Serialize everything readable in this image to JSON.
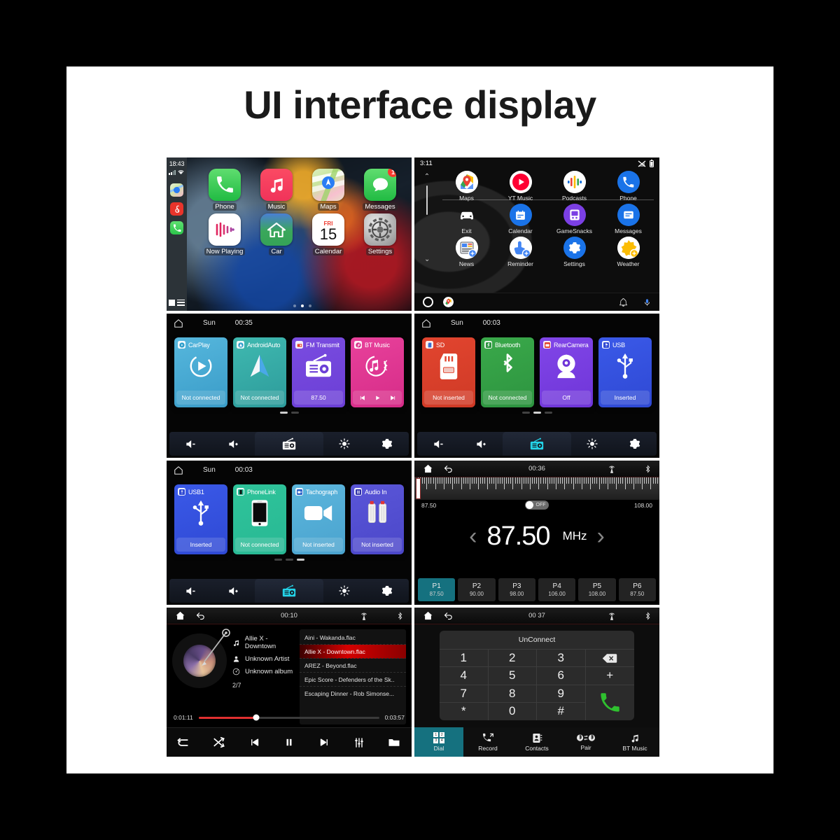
{
  "page": {
    "title": "UI interface display"
  },
  "carplay": {
    "status": {
      "time": "18:43",
      "signal_icon": "cellular-signal-icon",
      "wifi_icon": "wifi-icon"
    },
    "sidebar_icons": [
      "maps-icon",
      "netease-music-icon",
      "phone-icon"
    ],
    "dock_icon": "app-library-icon",
    "apps": [
      {
        "label": "Phone",
        "icon": "phone-icon",
        "badge": ""
      },
      {
        "label": "Music",
        "icon": "music-note-icon",
        "badge": ""
      },
      {
        "label": "Maps",
        "icon": "maps-icon",
        "badge": ""
      },
      {
        "label": "Messages",
        "icon": "messages-bubble-icon",
        "badge": "1"
      },
      {
        "label": "Now Playing",
        "icon": "now-playing-icon",
        "badge": ""
      },
      {
        "label": "Car",
        "icon": "home-car-icon",
        "badge": ""
      },
      {
        "label": "Calendar",
        "icon": "calendar-icon",
        "badge": "",
        "day_name": "FRI",
        "day_num": "15"
      },
      {
        "label": "Settings",
        "icon": "gear-icon",
        "badge": ""
      }
    ],
    "page_dots": {
      "count": 3,
      "active_index": 1
    }
  },
  "androidauto": {
    "status": {
      "time": "3:11",
      "signal_icon": "no-signal-icon",
      "battery_icon": "battery-icon"
    },
    "apps": [
      {
        "label": "Maps",
        "icon": "google-maps-icon"
      },
      {
        "label": "YT Music",
        "icon": "youtube-music-icon"
      },
      {
        "label": "Podcasts",
        "icon": "google-podcasts-icon"
      },
      {
        "label": "Phone",
        "icon": "phone-icon"
      },
      {
        "label": "Exit",
        "icon": "car-exit-icon"
      },
      {
        "label": "Calendar",
        "icon": "calendar-icon"
      },
      {
        "label": "GameSnacks",
        "icon": "gamesnacks-icon"
      },
      {
        "label": "Messages",
        "icon": "messages-icon"
      },
      {
        "label": "News",
        "icon": "news-icon"
      },
      {
        "label": "Reminder",
        "icon": "reminder-icon"
      },
      {
        "label": "Settings",
        "icon": "gear-icon"
      },
      {
        "label": "Weather",
        "icon": "weather-sun-icon"
      }
    ],
    "bottom": {
      "home_icon": "circle-home-icon",
      "maps_icon": "google-maps-icon",
      "bell_icon": "bell-icon",
      "mic_icon": "microphone-icon"
    }
  },
  "tiles_page1": {
    "header": {
      "home_icon": "home-icon",
      "day": "Sun",
      "time": "00:35"
    },
    "tiles": [
      {
        "name": "CarPlay",
        "badge_icon": "carplay-icon",
        "art_icon": "play-circle-icon",
        "status": "Not connected"
      },
      {
        "name": "AndroidAuto",
        "badge_icon": "androidauto-icon",
        "art_icon": "android-auto-arrow-icon",
        "status": "Not connected"
      },
      {
        "name": "FM Transmit",
        "badge_icon": "radio-icon",
        "art_icon": "radio-icon",
        "status": "87.50"
      },
      {
        "name": "BT Music",
        "badge_icon": "bt-music-icon",
        "art_icon": "bt-music-circle-icon",
        "status": "",
        "media_controls": [
          "prev-icon",
          "play-icon",
          "next-icon"
        ]
      }
    ],
    "page_dots": {
      "count": 2,
      "active_index": 0
    },
    "toolbar": [
      {
        "icon": "volume-down-icon",
        "active": false
      },
      {
        "icon": "volume-up-icon",
        "active": false
      },
      {
        "icon": "radio-icon",
        "active": false
      },
      {
        "icon": "brightness-icon",
        "active": false
      },
      {
        "icon": "gear-icon",
        "active": false
      }
    ]
  },
  "tiles_page2": {
    "header": {
      "home_icon": "home-icon",
      "day": "Sun",
      "time": "00:03"
    },
    "tiles": [
      {
        "name": "SD",
        "badge_icon": "sd-card-icon",
        "art_icon": "sd-card-icon",
        "status": "Not inserted"
      },
      {
        "name": "Bluetooth",
        "badge_icon": "bluetooth-icon",
        "art_icon": "bluetooth-icon",
        "status": "Not connected"
      },
      {
        "name": "RearCamera",
        "badge_icon": "camera-icon",
        "art_icon": "webcam-icon",
        "status": "Off"
      },
      {
        "name": "USB",
        "badge_icon": "usb-icon",
        "art_icon": "usb-icon",
        "status": "Inserted"
      }
    ],
    "page_dots": {
      "count": 3,
      "active_index": 1
    },
    "toolbar": [
      {
        "icon": "volume-down-icon",
        "active": false
      },
      {
        "icon": "volume-up-icon",
        "active": false
      },
      {
        "icon": "radio-icon",
        "active": true
      },
      {
        "icon": "brightness-icon",
        "active": false
      },
      {
        "icon": "gear-icon",
        "active": false
      }
    ]
  },
  "tiles_page3": {
    "header": {
      "home_icon": "home-icon",
      "day": "Sun",
      "time": "00:03"
    },
    "tiles": [
      {
        "name": "USB1",
        "badge_icon": "usb-icon",
        "art_icon": "usb-icon",
        "status": "Inserted"
      },
      {
        "name": "PhoneLink",
        "badge_icon": "phone-icon",
        "art_icon": "smartphone-icon",
        "status": "Not connected"
      },
      {
        "name": "Tachograph",
        "badge_icon": "video-icon",
        "art_icon": "video-camera-icon",
        "status": "Not inserted"
      },
      {
        "name": "Audio In",
        "badge_icon": "aux-icon",
        "art_icon": "aux-plug-icon",
        "status": "Not inserted"
      }
    ],
    "page_dots": {
      "count": 3,
      "active_index": 2
    },
    "toolbar": [
      {
        "icon": "volume-down-icon",
        "active": false
      },
      {
        "icon": "volume-up-icon",
        "active": false
      },
      {
        "icon": "radio-icon",
        "active": true
      },
      {
        "icon": "brightness-icon",
        "active": false
      },
      {
        "icon": "gear-icon",
        "active": false
      }
    ]
  },
  "radio": {
    "topbar": {
      "home_icon": "home-icon",
      "back_icon": "back-arrow-icon",
      "time": "00:36",
      "antenna_icon": "antenna-icon",
      "bluetooth_icon": "bluetooth-icon"
    },
    "band_min": "87.50",
    "band_max": "108.00",
    "toggle": {
      "label": "OFF",
      "state": "off"
    },
    "prev_icon": "chevron-left-icon",
    "next_icon": "chevron-right-icon",
    "frequency": "87.50",
    "unit": "MHz",
    "presets": [
      {
        "name": "P1",
        "freq": "87.50",
        "active": true
      },
      {
        "name": "P2",
        "freq": "90.00",
        "active": false
      },
      {
        "name": "P3",
        "freq": "98.00",
        "active": false
      },
      {
        "name": "P4",
        "freq": "106.00",
        "active": false
      },
      {
        "name": "P5",
        "freq": "108.00",
        "active": false
      },
      {
        "name": "P6",
        "freq": "87.50",
        "active": false
      }
    ]
  },
  "music": {
    "topbar": {
      "home_icon": "home-icon",
      "back_icon": "back-arrow-icon",
      "time": "00:10",
      "antenna_icon": "antenna-icon",
      "bluetooth_icon": "bluetooth-icon"
    },
    "album_art": "vinyl-record-icon",
    "title": "Allie X - Downtown",
    "artist": "Unknown Artist",
    "album": "Unknown album",
    "track_position": "2/7",
    "playlist": [
      {
        "name": "Aini - Wakanda.flac",
        "active": false
      },
      {
        "name": "Allie X - Downtown.flac",
        "active": true
      },
      {
        "name": "AREZ - Beyond.flac",
        "active": false
      },
      {
        "name": "Epic Score - Defenders of the Sk..",
        "active": false
      },
      {
        "name": "Escaping Dinner - Rob Simonse...",
        "active": false
      }
    ],
    "elapsed": "0:01:11",
    "duration": "0:03:57",
    "progress_percent": 32,
    "toolbar": [
      {
        "icon": "repeat-icon"
      },
      {
        "icon": "shuffle-icon"
      },
      {
        "icon": "previous-track-icon"
      },
      {
        "icon": "pause-icon"
      },
      {
        "icon": "next-track-icon"
      },
      {
        "icon": "equalizer-icon"
      },
      {
        "icon": "folder-icon"
      }
    ]
  },
  "dialer": {
    "topbar": {
      "home_icon": "home-icon",
      "back_icon": "back-arrow-icon",
      "time": "00 37",
      "antenna_icon": "antenna-icon",
      "bluetooth_icon": "bluetooth-icon"
    },
    "status_label": "UnConnect",
    "keys": [
      "1",
      "2",
      "3",
      "4",
      "5",
      "6",
      "7",
      "8",
      "9",
      "*",
      "0",
      "#"
    ],
    "backspace_icon": "backspace-icon",
    "plus_key": "+",
    "call_icon": "call-icon",
    "tabs": [
      {
        "label": "Dial",
        "icon": "dialpad-icon",
        "active": true
      },
      {
        "label": "Record",
        "icon": "call-record-icon",
        "active": false
      },
      {
        "label": "Contacts",
        "icon": "contacts-icon",
        "active": false
      },
      {
        "label": "Pair",
        "icon": "bluetooth-pair-icon",
        "active": false
      },
      {
        "label": "BT Music",
        "icon": "music-note-icon",
        "active": false
      }
    ]
  }
}
